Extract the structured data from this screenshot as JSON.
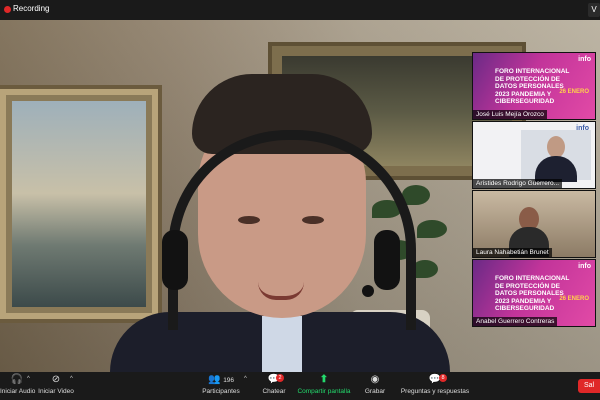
{
  "topbar": {
    "recording_label": "Recording",
    "view_label": "V"
  },
  "participants": [
    {
      "name": "José Luis Mejía Orozco",
      "type": "slide",
      "slide_title": "FORO INTERNACIONAL DE PROTECCIÓN DE DATOS PERSONALES 2023 PANDEMIA Y CIBERSEGURIDAD",
      "logo": "info",
      "date": "26 ENERO"
    },
    {
      "name": "Arístides Rodrigo Guerrero...",
      "type": "slide-with-speaker",
      "logo": "info"
    },
    {
      "name": "Laura Nahabetián Brunet",
      "type": "camera"
    },
    {
      "name": "Anabel Guerrero Contreras",
      "type": "slide",
      "slide_title": "FORO INTERNACIONAL DE PROTECCIÓN DE DATOS PERSONALES 2023 PANDEMIA Y CIBERSEGURIDAD",
      "logo": "info",
      "date": "26 ENERO"
    }
  ],
  "toolbar": {
    "audio_label": "Iniciar Audio",
    "video_label": "Iniciar Video",
    "participants_label": "Participantes",
    "participants_count": "196",
    "chat_label": "Chatear",
    "chat_badge": "2",
    "share_label": "Compartir pantalla",
    "record_label": "Grabar",
    "qa_label": "Preguntas y respuestas",
    "qa_badge": "8",
    "leave_label": "Sal"
  },
  "colors": {
    "recording": "#e02828",
    "share": "#23d96c",
    "leave": "#e02828",
    "toolbar_bg": "#1a1a1a"
  }
}
